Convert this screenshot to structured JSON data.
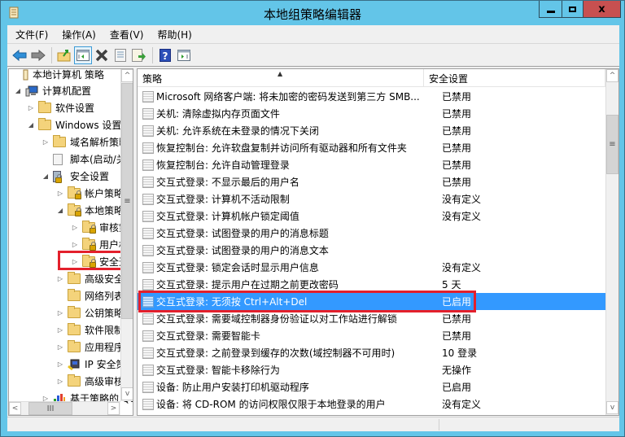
{
  "window": {
    "title": "本地组策略编辑器",
    "controls": {
      "minimize": "minimize",
      "maximize": "maximize",
      "close": "x"
    }
  },
  "menu": [
    "文件(F)",
    "操作(A)",
    "查看(V)",
    "帮助(H)"
  ],
  "toolbar": {
    "buttons": [
      "back-icon",
      "forward-icon",
      "up-folder-icon",
      "show-hide-tree-icon",
      "delete-icon",
      "properties-icon",
      "export-list-icon",
      "help-icon",
      "show-hide-action-pane-icon"
    ]
  },
  "tree": {
    "items": [
      {
        "label": "本地计算机 策略",
        "level": 0,
        "expander": "",
        "icon": "policy-scroll-icon"
      },
      {
        "label": "计算机配置",
        "level": 1,
        "expander": "expanded",
        "icon": "computer-icon"
      },
      {
        "label": "软件设置",
        "level": 2,
        "expander": "collapsed",
        "icon": "folder-icon"
      },
      {
        "label": "Windows 设置",
        "level": 2,
        "expander": "expanded",
        "icon": "folder-icon"
      },
      {
        "label": "域名解析策略",
        "level": 3,
        "expander": "collapsed",
        "icon": "folder-icon"
      },
      {
        "label": "脚本(启动/关机)",
        "level": 3,
        "expander": "",
        "icon": "script-icon"
      },
      {
        "label": "安全设置",
        "level": 3,
        "expander": "expanded",
        "icon": "security-settings-icon"
      },
      {
        "label": "帐户策略",
        "level": 4,
        "expander": "collapsed",
        "icon": "locked-folder-icon"
      },
      {
        "label": "本地策略",
        "level": 4,
        "expander": "expanded",
        "icon": "locked-folder-icon"
      },
      {
        "label": "审核策略",
        "level": 5,
        "expander": "collapsed",
        "icon": "locked-folder-icon"
      },
      {
        "label": "用户权限分配",
        "level": 5,
        "expander": "collapsed",
        "icon": "locked-folder-icon"
      },
      {
        "label": "安全选项",
        "level": 5,
        "expander": "collapsed",
        "icon": "locked-folder-icon",
        "highlighted": true
      },
      {
        "label": "高级安全 Windows 防火墙",
        "level": 4,
        "expander": "collapsed",
        "icon": "folder-icon"
      },
      {
        "label": "网络列表管理器策略",
        "level": 4,
        "expander": "",
        "icon": "folder-icon"
      },
      {
        "label": "公钥策略",
        "level": 4,
        "expander": "collapsed",
        "icon": "folder-icon"
      },
      {
        "label": "软件限制策略",
        "level": 4,
        "expander": "collapsed",
        "icon": "folder-icon"
      },
      {
        "label": "应用程序控制策略",
        "level": 4,
        "expander": "collapsed",
        "icon": "folder-icon"
      },
      {
        "label": "IP 安全策略",
        "level": 4,
        "expander": "collapsed",
        "icon": "ip-security-icon"
      },
      {
        "label": "高级审核策略配置",
        "level": 4,
        "expander": "collapsed",
        "icon": "folder-icon"
      },
      {
        "label": "基于策略的 QoS",
        "level": 3,
        "expander": "collapsed",
        "icon": "qos-chart-icon"
      }
    ]
  },
  "list": {
    "columns": [
      "策略",
      "安全设置"
    ],
    "rows": [
      {
        "policy": "Microsoft 网络客户端: 将未加密的密码发送到第三方 SMB...",
        "setting": "已禁用"
      },
      {
        "policy": "关机: 清除虚拟内存页面文件",
        "setting": "已禁用"
      },
      {
        "policy": "关机: 允许系统在未登录的情况下关闭",
        "setting": "已禁用"
      },
      {
        "policy": "恢复控制台: 允许软盘复制并访问所有驱动器和所有文件夹",
        "setting": "已禁用"
      },
      {
        "policy": "恢复控制台: 允许自动管理登录",
        "setting": "已禁用"
      },
      {
        "policy": "交互式登录: 不显示最后的用户名",
        "setting": "已禁用"
      },
      {
        "policy": "交互式登录: 计算机不活动限制",
        "setting": "没有定义"
      },
      {
        "policy": "交互式登录: 计算机帐户锁定阈值",
        "setting": "没有定义"
      },
      {
        "policy": "交互式登录: 试图登录的用户的消息标题",
        "setting": ""
      },
      {
        "policy": "交互式登录: 试图登录的用户的消息文本",
        "setting": ""
      },
      {
        "policy": "交互式登录: 锁定会话时显示用户信息",
        "setting": "没有定义"
      },
      {
        "policy": "交互式登录: 提示用户在过期之前更改密码",
        "setting": "5 天"
      },
      {
        "policy": "交互式登录: 无须按 Ctrl+Alt+Del",
        "setting": "已启用",
        "selected": true
      },
      {
        "policy": "交互式登录: 需要域控制器身份验证以对工作站进行解锁",
        "setting": "已禁用"
      },
      {
        "policy": "交互式登录: 需要智能卡",
        "setting": "已禁用"
      },
      {
        "policy": "交互式登录: 之前登录到缓存的次数(域控制器不可用时)",
        "setting": "10 登录"
      },
      {
        "policy": "交互式登录: 智能卡移除行为",
        "setting": "无操作"
      },
      {
        "policy": "设备: 防止用户安装打印机驱动程序",
        "setting": "已启用"
      },
      {
        "policy": "设备: 将 CD-ROM 的访问权限仅限于本地登录的用户",
        "setting": "没有定义"
      }
    ]
  },
  "scrollbars": {
    "up": "^",
    "down": "v",
    "left": "<",
    "right": ">",
    "grip": "≡",
    "hgrip": "III"
  },
  "colors": {
    "titlebar": "#63c5e8",
    "close": "#c75050",
    "selection": "#3399ff",
    "annotation": "#e3202c"
  }
}
